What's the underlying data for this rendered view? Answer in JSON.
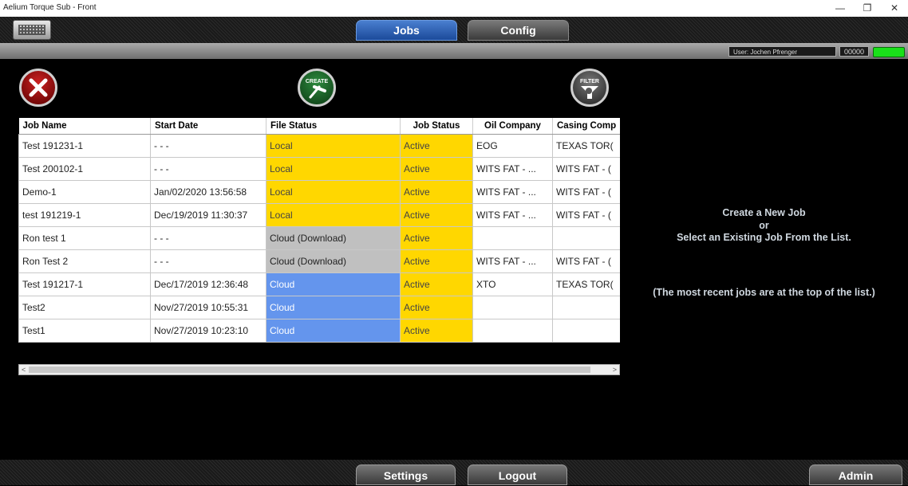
{
  "window": {
    "title": "Aelium Torque Sub - Front",
    "controls": {
      "minimize": "—",
      "restore": "❐",
      "close": "✕"
    }
  },
  "nav": {
    "jobs_label": "Jobs",
    "config_label": "Config",
    "keyboard_icon": "keyboard-icon"
  },
  "status": {
    "user": "User: Jochen Pfrenger",
    "count": "00000",
    "indicator_color": "#19e019"
  },
  "toolbar": {
    "close_icon": "x-circle-icon",
    "create_label": "CREATE",
    "filter_label": "FILTER"
  },
  "grid": {
    "columns": [
      "Job Name",
      "Start Date",
      "File Status",
      "Job Status",
      "Oil Company",
      "Casing Comp"
    ],
    "rows": [
      [
        "Test 191231-1",
        "- - -",
        "Local",
        "Active",
        "EOG",
        "TEXAS TOR("
      ],
      [
        "Test 200102-1",
        "- - -",
        "Local",
        "Active",
        "WITS FAT - ...",
        "WITS FAT - ("
      ],
      [
        "Demo-1",
        "Jan/02/2020 13:56:58",
        "Local",
        "Active",
        "WITS FAT - ...",
        "WITS FAT - ("
      ],
      [
        "test 191219-1",
        "Dec/19/2019 11:30:37",
        "Local",
        "Active",
        "WITS FAT - ...",
        "WITS FAT - ("
      ],
      [
        "Ron test 1",
        "- - -",
        "Cloud (Download)",
        "Active",
        "",
        ""
      ],
      [
        "Ron Test 2",
        "- - -",
        "Cloud (Download)",
        "Active",
        "WITS FAT - ...",
        "WITS FAT - ("
      ],
      [
        "Test 191217-1",
        "Dec/17/2019 12:36:48",
        "Cloud",
        "Active",
        "XTO",
        "TEXAS TOR("
      ],
      [
        "Test2",
        "Nov/27/2019 10:55:31",
        "Cloud",
        "Active",
        "",
        ""
      ],
      [
        "Test1",
        "Nov/27/2019 10:23:10",
        "Cloud",
        "Active",
        "",
        ""
      ]
    ],
    "scroll_left": "<",
    "scroll_right": ">"
  },
  "message": {
    "line1": "Create a New Job",
    "line2": "or",
    "line3": "Select an Existing Job From the List.",
    "note": "(The most recent jobs are at the top of the list.)"
  },
  "footer": {
    "settings_label": "Settings",
    "logout_label": "Logout",
    "admin_label": "Admin"
  },
  "colors": {
    "local": "#ffd700",
    "cloud_download": "#c0c0c0",
    "cloud": "#6495ed",
    "active": "#ffd700",
    "jobs_tab": "#2a5cae"
  }
}
